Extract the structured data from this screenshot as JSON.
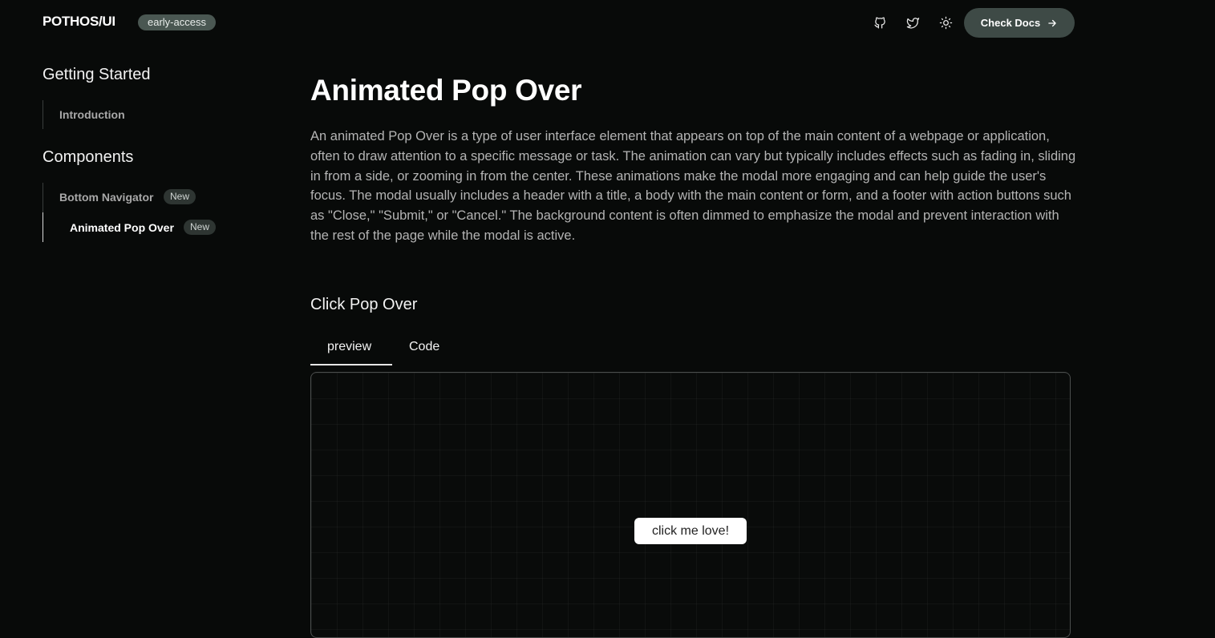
{
  "header": {
    "logo": "POTHOS/UI",
    "badge": "early-access",
    "icons": [
      "github-icon",
      "twitter-icon",
      "sun-icon"
    ],
    "docs_button": "Check Docs"
  },
  "sidebar": {
    "sections": [
      {
        "heading": "Getting Started",
        "items": [
          {
            "label": "Introduction"
          }
        ]
      },
      {
        "heading": "Components",
        "items": [
          {
            "label": "Bottom Navigator",
            "badge": "New"
          },
          {
            "label": "Animated Pop Over",
            "badge": "New",
            "active": true
          }
        ]
      }
    ]
  },
  "main": {
    "title": "Animated Pop Over",
    "description": "An animated Pop Over is a type of user interface element that appears on top of the main content of a webpage or application, often to draw attention to a specific message or task. The animation can vary but typically includes effects such as fading in, sliding in from a side, or zooming in from the center. These animations make the modal more engaging and can help guide the user's focus. The modal usually includes a header with a title, a body with the main content or form, and a footer with action buttons such as \"Close,\" \"Submit,\" or \"Cancel.\" The background content is often dimmed to emphasize the modal and prevent interaction with the rest of the page while the modal is active.",
    "section_title": "Click Pop Over",
    "tabs": [
      {
        "label": "preview",
        "active": true
      },
      {
        "label": "Code"
      }
    ],
    "preview_button": "click me love!"
  },
  "colors": {
    "background": "#080a09",
    "accent_button": "#3e4a46",
    "badge": "#4a5752"
  }
}
